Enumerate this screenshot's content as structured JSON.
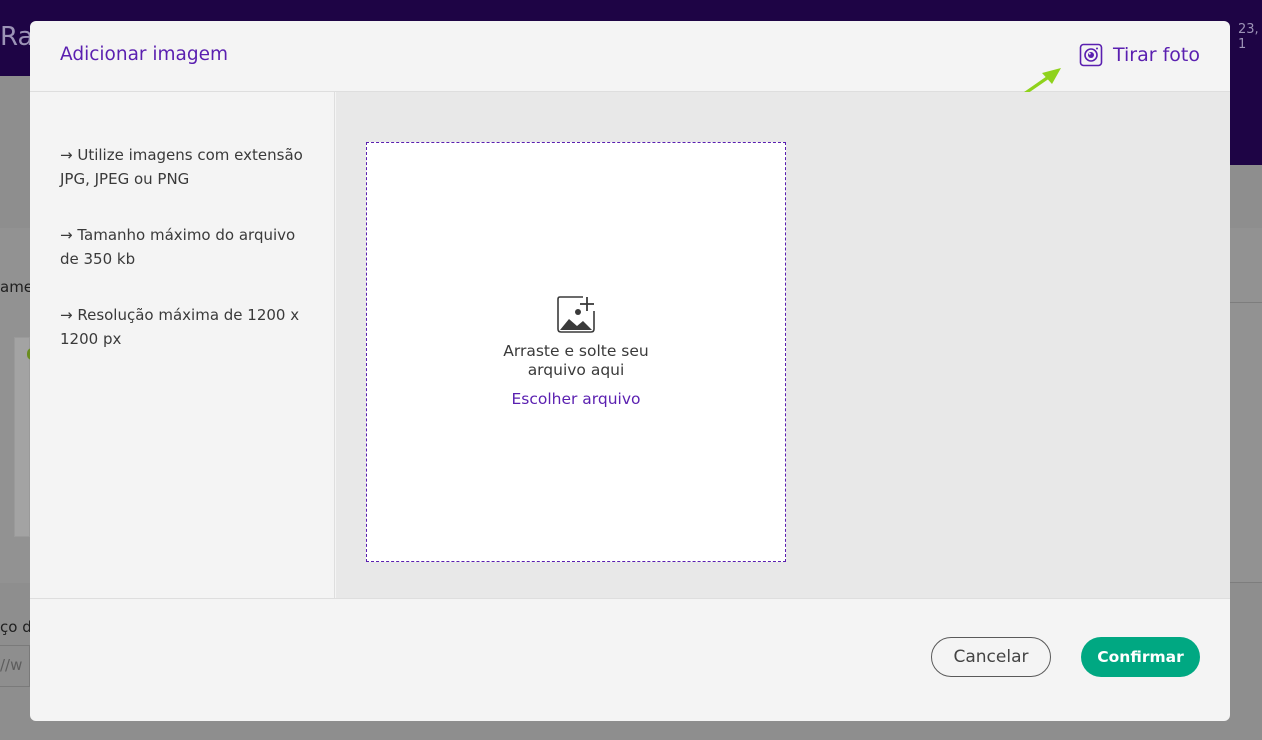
{
  "background": {
    "title_fragment": "Ra",
    "top_right_fragment": "23, 1",
    "side_label_1": "ame",
    "side_label_2": "ço d",
    "input_fragment": "//w"
  },
  "modal": {
    "title": "Adicionar imagem",
    "take_photo_label": "Tirar foto",
    "tips": [
      "→ Utilize imagens com extensão JPG, JPEG ou PNG",
      "→ Tamanho máximo do arquivo de 350 kb",
      "→ Resolução máxima de 1200 x 1200 px"
    ],
    "dropzone": {
      "line1": "Arraste e solte seu",
      "line2": "arquivo aqui",
      "choose_file_label": "Escolher arquivo"
    },
    "footer": {
      "cancel_label": "Cancelar",
      "confirm_label": "Confirmar"
    }
  },
  "colors": {
    "accent": "#5a1fb0",
    "confirm": "#00a882",
    "annotation_arrow": "#8fd21c",
    "header_bg": "#1e0445"
  },
  "icons": {
    "take_photo": "camera-icon",
    "dropzone": "add-image-icon",
    "annotation": "arrow-annotation-icon"
  }
}
